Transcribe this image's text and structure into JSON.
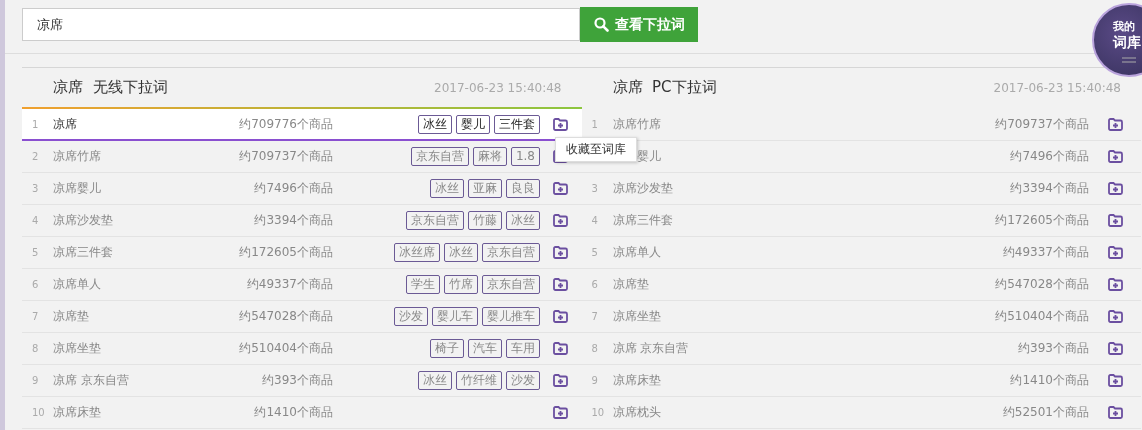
{
  "search": {
    "value": "凉席",
    "button": "查看下拉词"
  },
  "library_badge": {
    "line_1": "我的",
    "line_2": "词库"
  },
  "tooltip": "收藏至词库",
  "panels": [
    {
      "kind": "wireless",
      "keyword": "凉席",
      "title": "无线下拉词",
      "timestamp": "2017-06-23 15:40:48",
      "rows": [
        {
          "num": "1",
          "keyword": "凉席",
          "count": "约709776个商品",
          "tags": [
            "冰丝",
            "婴儿",
            "三件套"
          ],
          "selected": true
        },
        {
          "num": "2",
          "keyword": "凉席竹席",
          "count": "约709737个商品",
          "tags": [
            "京东自营",
            "麻将",
            "1.8"
          ],
          "selected": false
        },
        {
          "num": "3",
          "keyword": "凉席婴儿",
          "count": "约7496个商品",
          "tags": [
            "冰丝",
            "亚麻",
            "良良"
          ],
          "selected": false
        },
        {
          "num": "4",
          "keyword": "凉席沙发垫",
          "count": "约3394个商品",
          "tags": [
            "京东自营",
            "竹藤",
            "冰丝"
          ],
          "selected": false
        },
        {
          "num": "5",
          "keyword": "凉席三件套",
          "count": "约172605个商品",
          "tags": [
            "冰丝席",
            "冰丝",
            "京东自营"
          ],
          "selected": false
        },
        {
          "num": "6",
          "keyword": "凉席单人",
          "count": "约49337个商品",
          "tags": [
            "学生",
            "竹席",
            "京东自营"
          ],
          "selected": false
        },
        {
          "num": "7",
          "keyword": "凉席垫",
          "count": "约547028个商品",
          "tags": [
            "沙发",
            "婴儿车",
            "婴儿推车"
          ],
          "selected": false
        },
        {
          "num": "8",
          "keyword": "凉席坐垫",
          "count": "约510404个商品",
          "tags": [
            "椅子",
            "汽车",
            "车用"
          ],
          "selected": false
        },
        {
          "num": "9",
          "keyword": "凉席 京东自营",
          "count": "约393个商品",
          "tags": [
            "冰丝",
            "竹纤维",
            "沙发"
          ],
          "selected": false
        },
        {
          "num": "10",
          "keyword": "凉席床垫",
          "count": "约1410个商品",
          "selected": false
        }
      ]
    },
    {
      "kind": "pc",
      "keyword": "凉席",
      "title": "PC下拉词",
      "timestamp": "2017-06-23 15:40:48",
      "rows": [
        {
          "num": "1",
          "keyword": "凉席竹席",
          "count": "约709737个商品",
          "selected": false
        },
        {
          "kind": "covered",
          "keyword": "婴儿",
          "count": "约7496个商品",
          "selected": false
        },
        {
          "num": "3",
          "keyword": "凉席沙发垫",
          "count": "约3394个商品",
          "selected": false
        },
        {
          "num": "4",
          "keyword": "凉席三件套",
          "count": "约172605个商品",
          "selected": false
        },
        {
          "num": "5",
          "keyword": "凉席单人",
          "count": "约49337个商品",
          "selected": false
        },
        {
          "num": "6",
          "keyword": "凉席垫",
          "count": "约547028个商品",
          "selected": false
        },
        {
          "num": "7",
          "keyword": "凉席坐垫",
          "count": "约510404个商品",
          "selected": false
        },
        {
          "num": "8",
          "keyword": "凉席 京东自营",
          "count": "约393个商品",
          "selected": false
        },
        {
          "num": "9",
          "keyword": "凉席床垫",
          "count": "约1410个商品",
          "selected": false
        },
        {
          "num": "10",
          "keyword": "凉席枕头",
          "count": "约52501个商品",
          "selected": false
        }
      ]
    }
  ]
}
